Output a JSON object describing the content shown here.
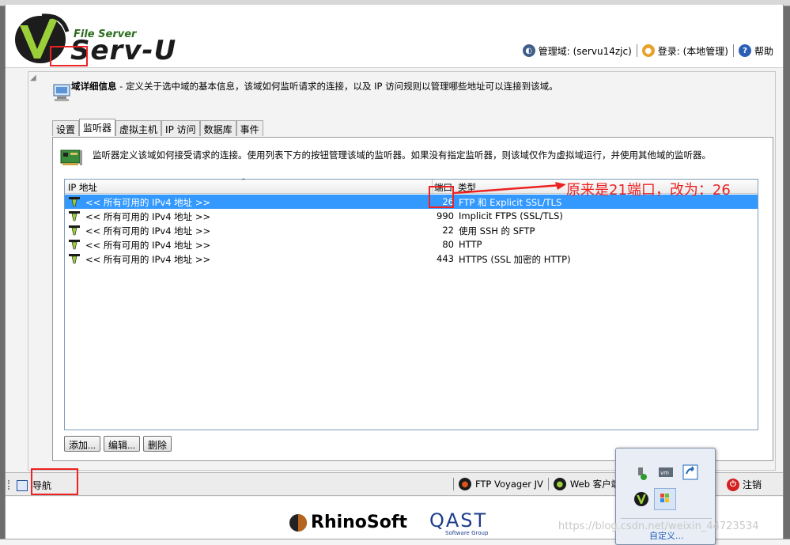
{
  "header": {
    "logo_small": "File Server",
    "logo_big": "Serv-U",
    "manage_domain": "管理域: (servu14zjc)",
    "login": "登录: (本地管理)",
    "help": "帮助"
  },
  "domain_info": {
    "title": "域详细信息",
    "description": " - 定义关于选中域的基本信息，该域如何监听请求的连接，以及 IP 访问规则以管理哪些地址可以连接到该域。"
  },
  "tabs": [
    "设置",
    "监听器",
    "虚拟主机",
    "IP 访问",
    "数据库",
    "事件"
  ],
  "active_tab": "监听器",
  "listener_description": "监听器定义该域如何接受请求的连接。使用列表下方的按钮管理该域的监听器。如果没有指定监听器，则该域仅作为虚拟域运行，并使用其他域的监听器。",
  "listview": {
    "columns": {
      "ip": "IP 地址",
      "port": "端口",
      "type": "类型"
    },
    "rows": [
      {
        "ip": "<< 所有可用的 IPv4 地址 >>",
        "port": "26",
        "type": "FTP 和 Explicit SSL/TLS",
        "selected": true
      },
      {
        "ip": "<< 所有可用的 IPv4 地址 >>",
        "port": "990",
        "type": "Implicit FTPS (SSL/TLS)",
        "selected": false
      },
      {
        "ip": "<< 所有可用的 IPv4 地址 >>",
        "port": "22",
        "type": "使用 SSH 的 SFTP",
        "selected": false
      },
      {
        "ip": "<< 所有可用的 IPv4 地址 >>",
        "port": "80",
        "type": "HTTP",
        "selected": false
      },
      {
        "ip": "<< 所有可用的 IPv4 地址 >>",
        "port": "443",
        "type": "HTTPS (SSL 加密的 HTTP)",
        "selected": false
      }
    ]
  },
  "buttons": {
    "add": "添加...",
    "edit": "编辑...",
    "delete": "删除"
  },
  "annotation": "原来是21端口，改为：26",
  "statusbar": {
    "nav": "导航",
    "ftp_voyager": "FTP Voyager JV",
    "web_client": "Web 客户端",
    "signout": "注销"
  },
  "footer": {
    "rhinosoft": "RhinoSoft",
    "qast": "QAST",
    "qast_sub": "Software Group"
  },
  "tray": {
    "customize": "自定义..."
  },
  "watermark": "https://blog.csdn.net/weixin_44723534",
  "colors": {
    "selected_row": "#3399ff",
    "annotation_red": "#e22222",
    "accent_green": "#2c6d1f"
  }
}
